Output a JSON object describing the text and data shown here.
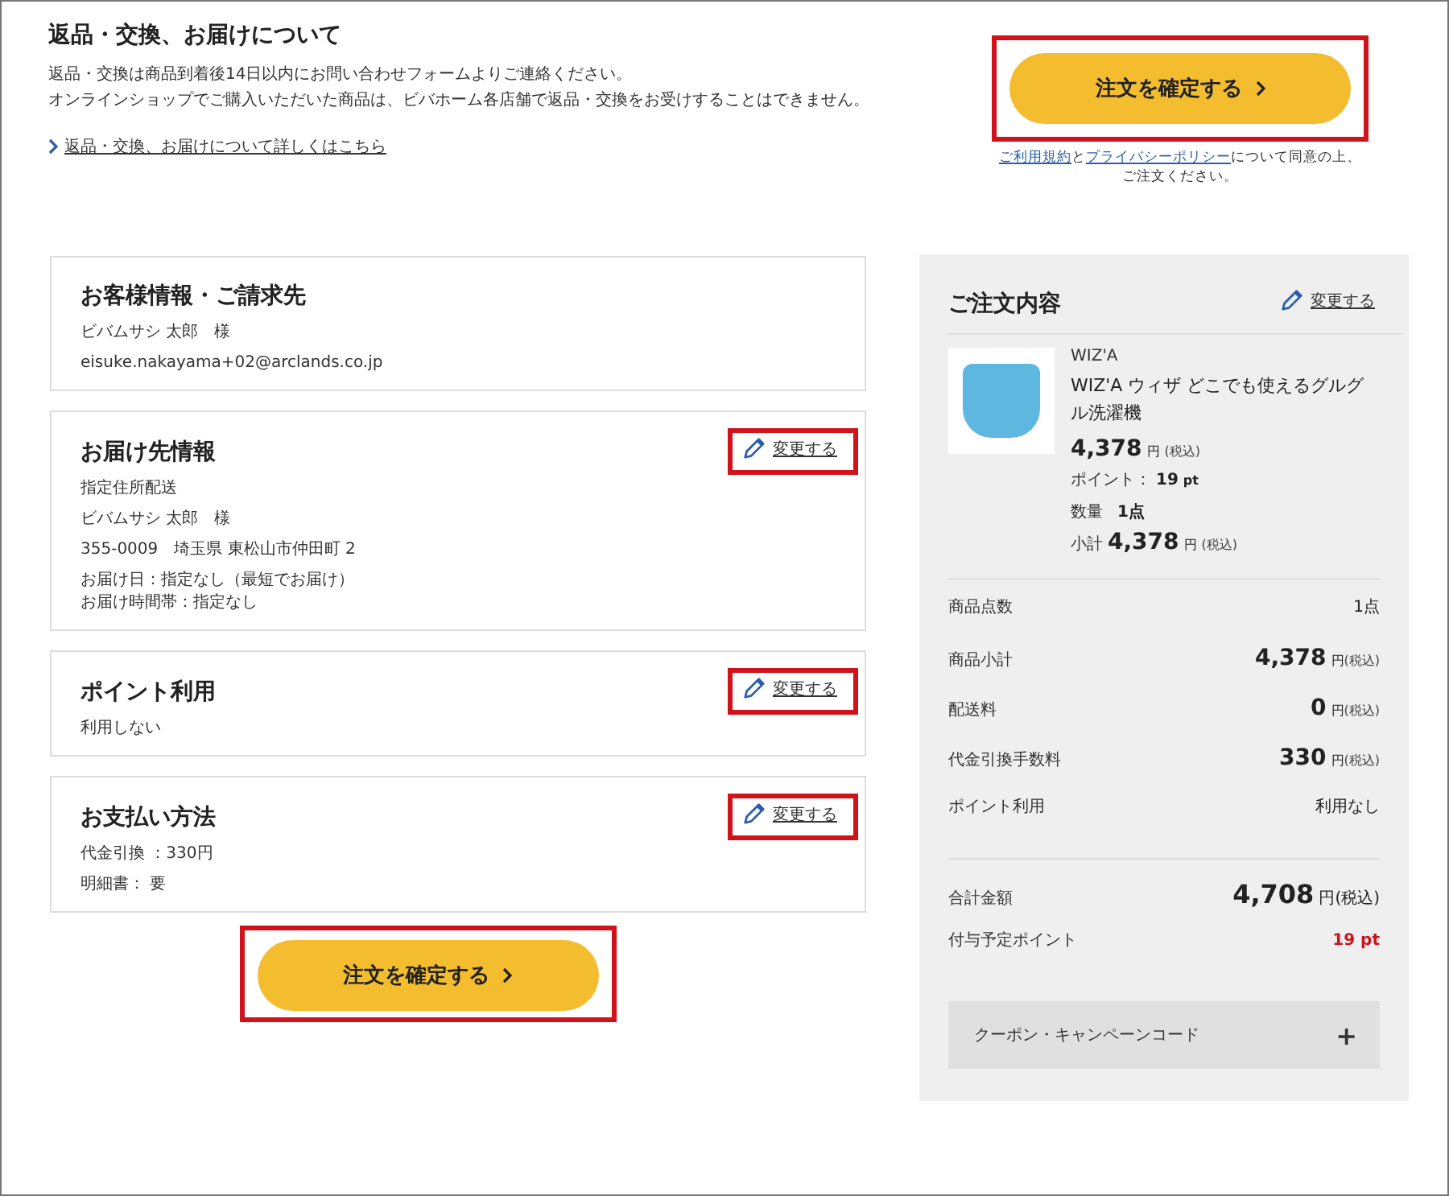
{
  "returns_notice": {
    "title": "返品・交換、お届けについて",
    "lines": [
      "返品・交換は商品到着後14日以内にお問い合わせフォームよりご連絡ください。",
      "オンラインショップでご購入いただいた商品は、ビバホーム各店舗で返品・交換をお受けすることはできません。"
    ],
    "link": "返品・交換、お届けについて詳しくはこちら"
  },
  "confirm_top": {
    "label": "注文を確定する",
    "highlighted": true
  },
  "terms": {
    "link_terms": "ご利用規約",
    "joiner": "と",
    "link_privacy": "プライバシーポリシー",
    "rest": "について同意の上、",
    "line2": "ご注文ください。"
  },
  "cards": [
    {
      "title": "お客様情報・ご請求先",
      "paragraphs": [
        [
          "ビバムサシ 太郎　様"
        ],
        [
          "eisuke.nakayama+02@arclands.co.jp"
        ]
      ]
    },
    {
      "title": "お届け先情報",
      "edit": {
        "label": "変更する",
        "highlighted": true
      },
      "paragraphs": [
        [
          "指定住所配送"
        ],
        [
          "ビバムサシ 太郎　様"
        ],
        [
          "355-0009　埼玉県 東松山市仲田町 2"
        ],
        [
          "お届け日：指定なし（最短でお届け）",
          "お届け時間帯：指定なし"
        ]
      ]
    },
    {
      "title": "ポイント利用",
      "edit": {
        "label": "変更する",
        "highlighted": true
      },
      "paragraphs": [
        [
          "利用しない"
        ]
      ]
    },
    {
      "title": "お支払い方法",
      "edit": {
        "label": "変更する",
        "highlighted": true
      },
      "paragraphs": [
        [
          "代金引換 ：330円"
        ],
        [
          "明細書： 要"
        ]
      ]
    }
  ],
  "confirm_bottom": {
    "label": "注文を確定する",
    "highlighted": true
  },
  "order": {
    "title": "ご注文内容",
    "edit": {
      "label": "変更する",
      "highlighted": false
    },
    "item": {
      "brand": "WIZ'A",
      "name": "WIZ'A ウィザ どこでも使えるグルグル洗濯機",
      "price": "4,378",
      "yen": "円",
      "tax": "(税込)",
      "points_label": "ポイント：",
      "points": "19",
      "points_unit": "pt",
      "qty_label": "数量",
      "qty": "1点",
      "subtotal_label": "小計",
      "subtotal": "4,378",
      "subtotal_yen": "円",
      "subtotal_tax": "(税込)"
    },
    "summary": [
      {
        "kind": "text",
        "label": "商品点数",
        "value": "1点"
      },
      {
        "kind": "price",
        "label": "商品小計",
        "value": "4,378",
        "yen": "円",
        "tax": "(税込)"
      },
      {
        "kind": "price",
        "label": "配送料",
        "value": "0",
        "yen": "円",
        "tax": "(税込)"
      },
      {
        "kind": "price",
        "label": "代金引換手数料",
        "value": "330",
        "yen": "円",
        "tax": "(税込)"
      },
      {
        "kind": "text",
        "label": "ポイント利用",
        "value": "利用なし"
      }
    ],
    "totals": [
      {
        "kind": "total",
        "label": "合計金額",
        "value": "4,708",
        "yen": "円",
        "tax": "(税込)"
      },
      {
        "kind": "points",
        "label": "付与予定ポイント",
        "value": "19 pt"
      }
    ],
    "coupon": {
      "label": "クーポン・キャンペーンコード",
      "toggle": "+"
    }
  }
}
